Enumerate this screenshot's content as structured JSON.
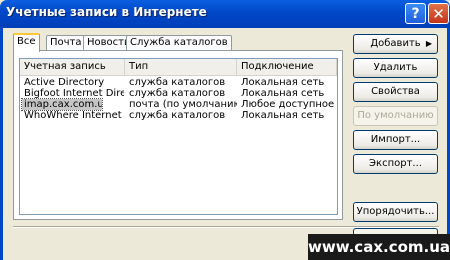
{
  "window": {
    "title": "Учетные записи в Интернете",
    "help_glyph": "?",
    "close_glyph": "✕"
  },
  "tabs": [
    "Все",
    "Почта",
    "Новости",
    "Служба каталогов"
  ],
  "list": {
    "columns": [
      "Учетная запись",
      "Тип",
      "Подключение"
    ],
    "rows": [
      [
        "Active Directory",
        "служба каталогов",
        "Локальная сеть"
      ],
      [
        "Bigfoot Internet Directo...",
        "служба каталогов",
        "Локальная сеть"
      ],
      [
        "imap.cax.com.ua",
        "почта (по умолчанию)",
        "Любое доступное"
      ],
      [
        "WhoWhere Internet Dir...",
        "служба каталогов",
        "Локальная сеть"
      ]
    ],
    "selected_index": 2
  },
  "buttons": {
    "add": "Добавить",
    "delete": "Удалить",
    "properties": "Свойства",
    "default": "По умолчанию",
    "import": "Импорт...",
    "export": "Экспорт...",
    "order": "Упорядочить..."
  },
  "watermark": "www.cax.com.ua",
  "colors": {
    "titlebar": "#0047C8",
    "selection": "#C6C6C6",
    "active_tab": "#FFC83C"
  }
}
